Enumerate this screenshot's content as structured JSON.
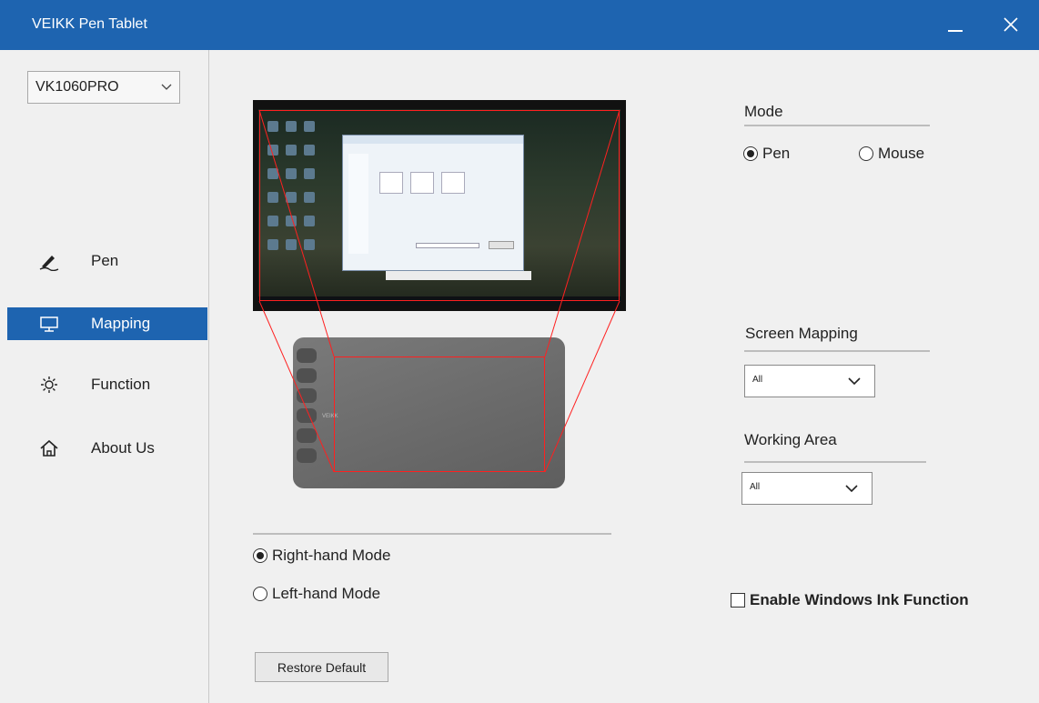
{
  "window": {
    "title": "VEIKK Pen Tablet",
    "accent_color": "#1e64b0"
  },
  "sidebar": {
    "device": "VK1060PRO",
    "items": [
      {
        "label": "Pen",
        "icon": "pen-icon",
        "active": false
      },
      {
        "label": "Mapping",
        "icon": "monitor-icon",
        "active": true
      },
      {
        "label": "Function",
        "icon": "gear-icon",
        "active": false
      },
      {
        "label": "About Us",
        "icon": "home-icon",
        "active": false
      }
    ]
  },
  "mode": {
    "label": "Mode",
    "options": [
      {
        "label": "Pen",
        "selected": true
      },
      {
        "label": "Mouse",
        "selected": false
      }
    ]
  },
  "screen_mapping": {
    "label": "Screen Mapping",
    "value": "All"
  },
  "working_area": {
    "label": "Working Area",
    "value": "All"
  },
  "hand_mode": {
    "options": [
      {
        "label": "Right-hand Mode",
        "selected": true
      },
      {
        "label": "Left-hand Mode",
        "selected": false
      }
    ]
  },
  "windows_ink": {
    "label": "Enable Windows Ink Function",
    "checked": false
  },
  "restore_label": "Restore Default",
  "mapping_line_color": "#ff2020"
}
